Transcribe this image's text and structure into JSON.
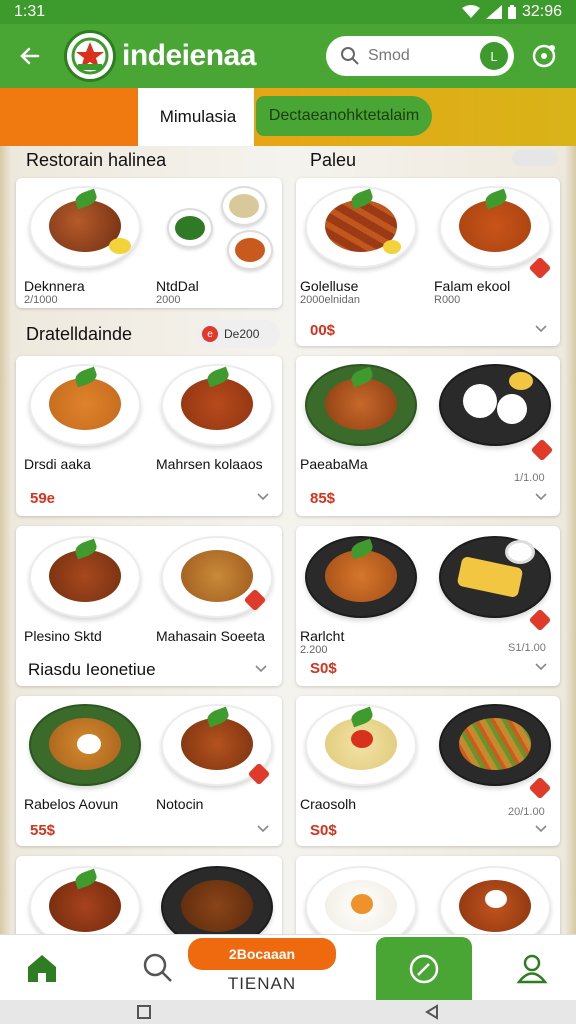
{
  "status_bar": {
    "time": "1:31",
    "battery": "32:96"
  },
  "app_bar": {
    "title": "indeienaa",
    "search_placeholder": "Smod",
    "search_button": "L"
  },
  "tabs": [
    {
      "label": "Mimulasia",
      "active": true
    },
    {
      "label": "Dectaeanohktetalaim",
      "active": false
    }
  ],
  "sections": {
    "left_top": "Restorain halinea",
    "right_top": "Paleu",
    "left_mid": "Dratelldainde",
    "chip_label": "De200",
    "chip_dot": "e",
    "left_lower": "Riasdu Ieonetiue"
  },
  "items": [
    {
      "name": "Deknnera",
      "sub": "2/1000"
    },
    {
      "name": "NtdDal",
      "sub": "2000"
    },
    {
      "name": "Golelluse",
      "sub": "2000elnidan"
    },
    {
      "name": "Falam ekool",
      "sub": "R000"
    },
    {
      "name": "Drsdi aaka",
      "sub": ""
    },
    {
      "name": "Mahrsen kolaaos",
      "sub": ""
    },
    {
      "name": "PaeabaMa",
      "sub": ""
    },
    {
      "name": "",
      "sub": ""
    },
    {
      "name": "Plesino Sktd",
      "sub": ""
    },
    {
      "name": "Mahasain Soeeta",
      "sub": ""
    },
    {
      "name": "Rarlcht",
      "sub": "2.200"
    },
    {
      "name": "",
      "sub": ""
    },
    {
      "name": "Rabelos Aovun",
      "sub": ""
    },
    {
      "name": "Notocin",
      "sub": ""
    },
    {
      "name": "Craosolh",
      "sub": ""
    },
    {
      "name": "",
      "sub": ""
    }
  ],
  "prices": {
    "card2": "00$",
    "card3": "59e",
    "card4": "85$",
    "card5": "",
    "card6": "S0$",
    "card7": "55$",
    "card8": "S0$"
  },
  "minor_labels": {
    "card4": "1/1.00",
    "card6": "S1/1.00",
    "card8": "20/1.00"
  },
  "bottom_nav": {
    "badge": "2Bocaaan",
    "center_label": "TIENAN"
  },
  "colors": {
    "primary_green": "#4aa634",
    "accent_orange": "#f07a10",
    "accent_yellow": "#d8b419",
    "price_red": "#d8321c"
  },
  "icons": [
    "back-arrow-icon",
    "logo-emblem-icon",
    "search-icon",
    "settings-icon",
    "home-icon",
    "search-nav-icon",
    "compass-icon",
    "profile-icon",
    "chevron-down-icon"
  ]
}
